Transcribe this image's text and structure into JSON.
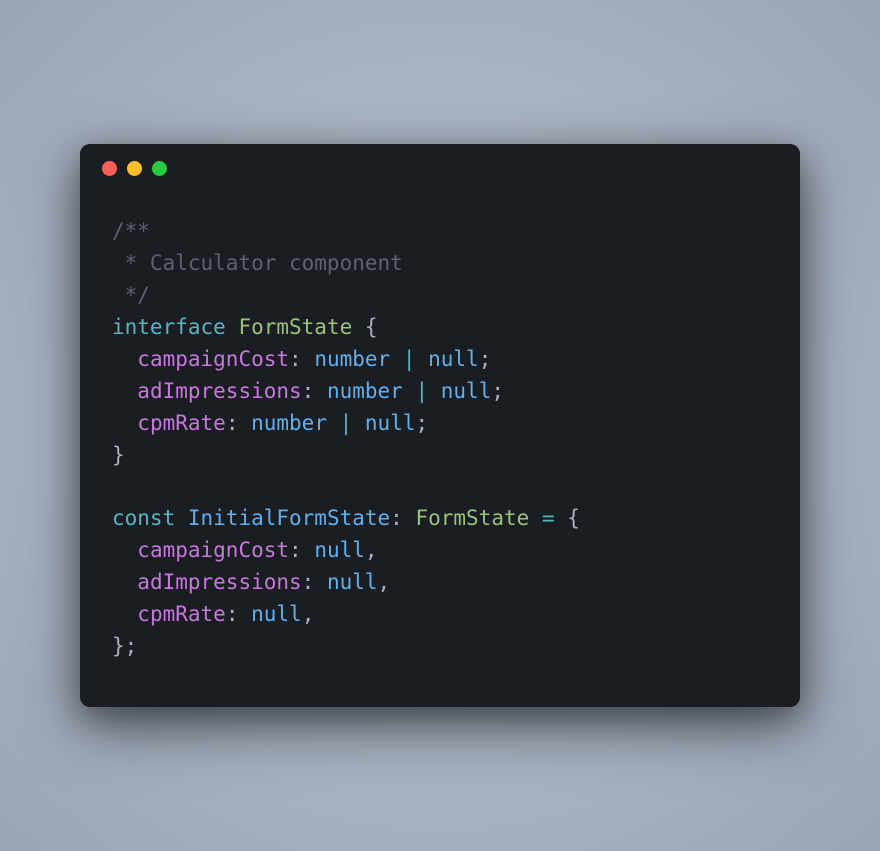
{
  "colors": {
    "bg_outer": "#9aa5b5",
    "bg_window": "#1a1d21",
    "traffic_red": "#ff5f56",
    "traffic_yellow": "#ffbd2e",
    "traffic_green": "#27c93f",
    "comment": "#5c6370",
    "keyword": "#56b6c2",
    "type": "#98c379",
    "property": "#c678dd",
    "builtin": "#61afef",
    "default": "#abb2bf"
  },
  "code": {
    "c1": "/**",
    "c2": " * Calculator component",
    "c3": " */",
    "kw_interface": "interface",
    "type_formstate": "FormState",
    "brace_open": " {",
    "prop_campaignCost": "campaignCost",
    "prop_adImpressions": "adImpressions",
    "prop_cpmRate": "cpmRate",
    "colon": ": ",
    "builtin_number": "number",
    "pipe": " | ",
    "builtin_null": "null",
    "semi": ";",
    "brace_close": "}",
    "kw_const": "const",
    "var_initial": "InitialFormState",
    "eq": " = ",
    "comma": ",",
    "indent": "  "
  }
}
